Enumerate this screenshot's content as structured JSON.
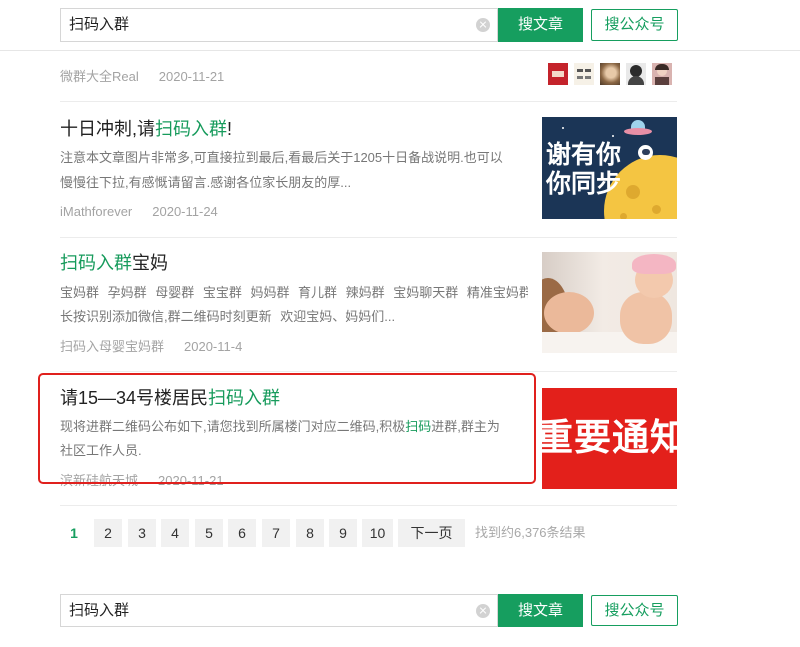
{
  "colors": {
    "accent": "#169e5f",
    "highlight": "#179b5c",
    "annotation_box": "#e0201d"
  },
  "search_top": {
    "query": "扫码入群",
    "article_button": "搜文章",
    "account_button": "搜公众号"
  },
  "results": [
    {
      "source": "微群大全Real",
      "date": "2020-11-21"
    },
    {
      "title": [
        {
          "text": "十日冲刺,请"
        },
        {
          "text": "扫码入群",
          "highlight": true
        },
        {
          "text": "!"
        }
      ],
      "desc": [
        [
          {
            "text": "注意本文章图片非常多,可直接拉到最后,看最后关于1205十日备战说明.也可以"
          }
        ],
        [
          {
            "text": "慢慢往下拉,有感慨请留言.感谢各位家长朋友的厚..."
          }
        ]
      ],
      "source": "iMathforever",
      "date": "2020-11-24",
      "thumbnail_text": [
        "谢有你",
        "你同步"
      ]
    },
    {
      "title": [
        {
          "text": "扫码入群",
          "highlight": true
        },
        {
          "text": "宝妈"
        }
      ],
      "desc": [
        [
          {
            "text": "宝妈群 孕妈群 母婴群 宝宝群 妈妈群 育儿群 辣妈群 宝妈聊天群 精准宝妈群"
          }
        ],
        [
          {
            "text": "长按识别添加微信,群二维码时刻更新 欢迎宝妈、妈妈们..."
          }
        ]
      ],
      "source": "扫码入母婴宝妈群",
      "date": "2020-11-4"
    },
    {
      "title": [
        {
          "text": "请15—34号楼居民"
        },
        {
          "text": "扫码入群",
          "highlight": true
        }
      ],
      "desc": [
        [
          {
            "text": "现将进群二维码公布如下,请您找到所属楼门对应二维码,积极"
          },
          {
            "text": "扫码",
            "highlight": true
          },
          {
            "text": "进群,群主为"
          }
        ],
        [
          {
            "text": "社区工作人员."
          }
        ]
      ],
      "source": "滨新硅航天城",
      "date": "2020-11-21",
      "thumbnail_text": "重要通知"
    }
  ],
  "pagination": {
    "current": "1",
    "pages": [
      "2",
      "3",
      "4",
      "5",
      "6",
      "7",
      "8",
      "9",
      "10"
    ],
    "next": "下一页",
    "summary": "找到约6,376条结果"
  },
  "search_bottom": {
    "query": "扫码入群",
    "article_button": "搜文章",
    "account_button": "搜公众号"
  }
}
